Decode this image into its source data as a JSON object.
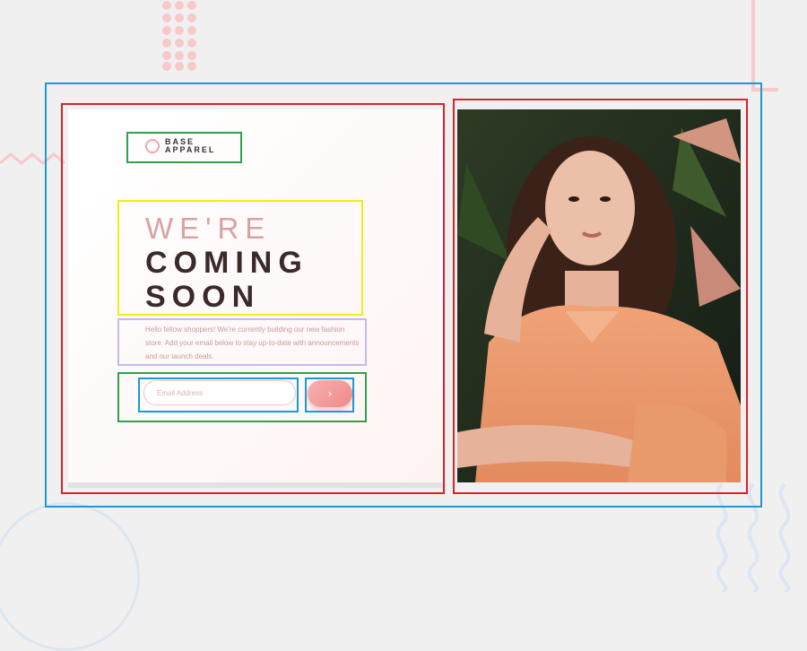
{
  "brand": {
    "line1": "BASE",
    "line2": "APPAREL"
  },
  "headline": {
    "light": "WE'RE",
    "dark1": "COMING",
    "dark2": "SOON"
  },
  "description": "Hello fellow shoppers! We're currently building our new fashion store. Add your email below to stay up-to-date with announcements and our launch deals.",
  "form": {
    "email_placeholder": "Email Address",
    "submit_icon": "arrow-right-icon",
    "submit_glyph": "›"
  },
  "colors": {
    "accent": "#ee8a8a",
    "accent_light": "#f7b0b0",
    "text_dark": "#3b2a2a",
    "text_muted": "#c89a9a",
    "annotation_blue": "#1a9ad6",
    "annotation_red": "#d8232a",
    "annotation_green": "#2fa14c",
    "annotation_yellow": "#f5ea1a",
    "annotation_lavender": "#c6b9e4"
  }
}
